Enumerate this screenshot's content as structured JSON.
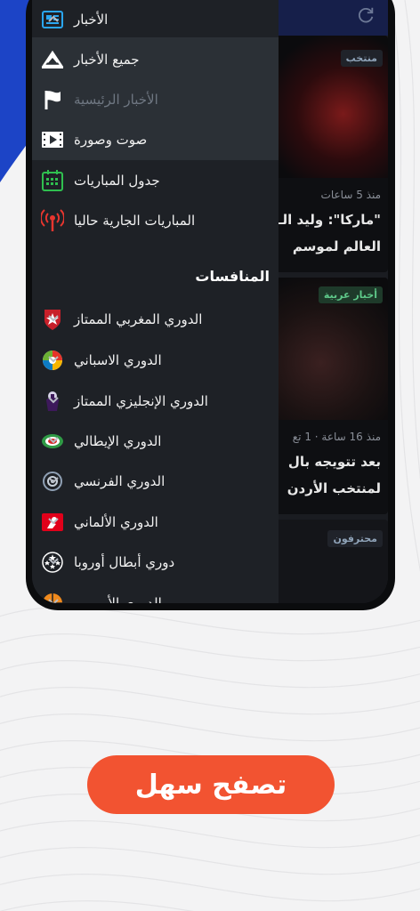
{
  "drawer": {
    "header": {
      "label": "الأخبار",
      "icon": "newspaper-icon",
      "expanded": true
    },
    "sub_items": [
      {
        "label": "جميع الأخبار",
        "icon": "logo-icon",
        "dim": false
      },
      {
        "label": "الأخبار الرئيسية",
        "icon": "flag-icon",
        "dim": true
      },
      {
        "label": "صوت وصورة",
        "icon": "video-icon",
        "dim": false
      }
    ],
    "items": [
      {
        "label": "جدول المباريات",
        "icon": "calendar-icon"
      },
      {
        "label": "المباريات الجارية حاليا",
        "icon": "live-broadcast-icon"
      }
    ],
    "section_title": "المنافسات",
    "competitions": [
      {
        "label": "الدوري المغربي الممتاز",
        "icon": "botola-logo-icon"
      },
      {
        "label": "الدوري الاسباني",
        "icon": "laliga-logo-icon"
      },
      {
        "label": "الدوري الإنجليزي الممتاز",
        "icon": "premier-league-logo-icon"
      },
      {
        "label": "الدوري الإيطالي",
        "icon": "serie-a-logo-icon"
      },
      {
        "label": "الدوري الفرنسي",
        "icon": "ligue1-logo-icon"
      },
      {
        "label": "الدوري الألماني",
        "icon": "bundesliga-logo-icon"
      },
      {
        "label": "دوري أبطال أوروبا",
        "icon": "champions-league-logo-icon"
      },
      {
        "label": "الدوري الأوروبي",
        "icon": "europa-league-logo-icon"
      }
    ]
  },
  "feed": {
    "cards": [
      {
        "tag": "منتخب",
        "meta": "منذ 5 ساعات",
        "headline_1": "\"ماركا\": وليد الـ",
        "headline_2": "العالم لموسم"
      },
      {
        "tag": "أخبار عربية",
        "meta": "منذ 16 ساعة · 1 تع",
        "headline_1": "بعد تتويجه بال",
        "headline_2": "لمنتخب الأردن"
      },
      {
        "tag": "محترفون"
      }
    ]
  },
  "cta": {
    "label": "تصفح سهل"
  },
  "colors": {
    "cta": "#f25331",
    "drawer_bg": "#1e2126",
    "submenu_bg": "#2b3036",
    "accent_blue": "#1c44c6"
  }
}
